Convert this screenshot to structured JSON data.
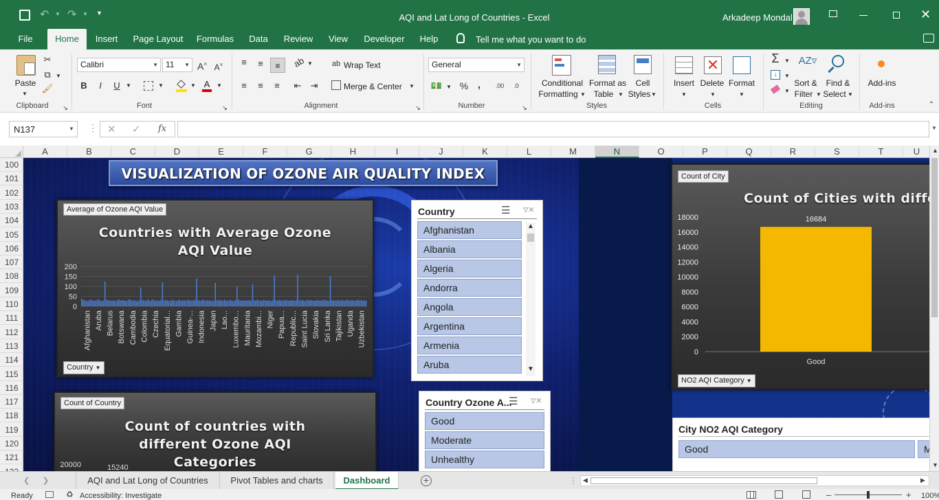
{
  "titlebar": {
    "doc_title": "AQI and Lat Long of Countries  -  Excel",
    "user": "Arkadeep Mondal"
  },
  "ribbon_tabs": [
    "File",
    "Home",
    "Insert",
    "Page Layout",
    "Formulas",
    "Data",
    "Review",
    "View",
    "Developer",
    "Help"
  ],
  "tell_me": "Tell me what you want to do",
  "ribbon": {
    "paste": "Paste",
    "font_name": "Calibri",
    "font_size": "11",
    "wrap_text": "Wrap Text",
    "merge_center": "Merge & Center",
    "number_format": "General",
    "cond_fmt_1": "Conditional",
    "cond_fmt_2": "Formatting",
    "fmt_table_1": "Format as",
    "fmt_table_2": "Table",
    "cell_styles_1": "Cell",
    "cell_styles_2": "Styles",
    "insert": "Insert",
    "delete": "Delete",
    "format": "Format",
    "sort_1": "Sort &",
    "sort_2": "Filter",
    "find_1": "Find &",
    "find_2": "Select",
    "addins": "Add-ins",
    "groups": {
      "clipboard": "Clipboard",
      "font": "Font",
      "alignment": "Alignment",
      "number": "Number",
      "styles": "Styles",
      "cells": "Cells",
      "editing": "Editing",
      "addins": "Add-ins"
    }
  },
  "formula_bar": {
    "name_box": "N137",
    "fx": "fx",
    "formula": ""
  },
  "columns": [
    "A",
    "B",
    "C",
    "D",
    "E",
    "F",
    "G",
    "H",
    "I",
    "J",
    "K",
    "L",
    "M",
    "N",
    "O",
    "P",
    "Q",
    "R",
    "S",
    "T",
    "U"
  ],
  "selected_column": "N",
  "rows": [
    "100",
    "101",
    "102",
    "103",
    "104",
    "105",
    "106",
    "107",
    "108",
    "109",
    "110",
    "111",
    "112",
    "113",
    "114",
    "115",
    "116",
    "117",
    "118",
    "119",
    "120",
    "121",
    "122"
  ],
  "dashboard": {
    "banner": "VISUALIZATION OF OZONE AIR QUALITY INDEX",
    "chart1": {
      "tag": "Average of Ozone AQI Value",
      "title": "Countries with Average Ozone AQI Value",
      "filter": "Country"
    },
    "chart2": {
      "tag": "Count of Country",
      "title": "Count of countries with different Ozone AQI Categories"
    },
    "chart3": {
      "tag": "Count of City",
      "title": "Count of Cities with differe",
      "filter": "NO2 AQI Category"
    },
    "slicer_country": {
      "title": "Country",
      "items": [
        "Afghanistan",
        "Albania",
        "Algeria",
        "Andorra",
        "Angola",
        "Argentina",
        "Armenia",
        "Aruba"
      ]
    },
    "slicer_ozone": {
      "title": "Country Ozone A...",
      "items": [
        "Good",
        "Moderate",
        "Unhealthy"
      ]
    },
    "slicer_no2": {
      "title": "City NO2 AQI Category",
      "items": [
        "Good",
        "M"
      ]
    }
  },
  "chart_data": [
    {
      "type": "bar",
      "title": "Countries with Average Ozone AQI Value",
      "ylim": [
        0,
        200
      ],
      "yticks": [
        "200",
        "150",
        "100",
        "50",
        "0"
      ],
      "category_labels": [
        "Afghanistan",
        "Aruba",
        "Belarus",
        "Botswana",
        "Cambodia",
        "Colombia",
        "Czechia",
        "Equatorial...",
        "Gambia",
        "Guinea-...",
        "Indonesia",
        "Japan",
        "Lao...",
        "Luxembo...",
        "Mauritania",
        "Mozambi...",
        "Niger",
        "Papua...",
        "Republic...",
        "Saint Lucia",
        "Slovakia",
        "Sri Lanka",
        "Tajikistan",
        "Uganda",
        "Uzbekistan"
      ],
      "values": [
        38,
        33,
        30,
        28,
        26,
        31,
        34,
        30,
        29,
        27,
        32,
        35,
        28,
        26,
        30,
        125,
        33,
        29,
        31,
        27,
        28,
        30,
        26,
        32,
        34,
        29,
        31,
        30,
        28,
        27,
        33,
        35,
        29,
        30,
        31,
        27,
        26,
        30,
        95,
        32,
        29,
        28,
        30,
        33,
        26,
        31,
        34,
        28,
        29,
        30,
        27,
        32,
        120,
        30,
        29,
        31,
        28,
        27,
        33,
        30,
        29,
        26,
        31,
        32,
        28,
        30,
        29,
        27,
        33,
        31,
        28,
        29,
        30,
        32,
        140,
        31,
        28,
        29,
        33,
        30,
        27,
        31,
        29,
        28,
        30,
        26,
        118,
        32,
        29,
        31,
        30,
        28,
        33,
        27,
        29,
        30,
        31,
        28,
        26,
        32,
        100,
        33,
        29,
        30,
        28,
        31,
        27,
        32,
        30,
        29,
        110,
        31,
        28,
        33,
        30,
        27,
        29,
        32,
        31,
        28,
        30,
        29,
        26,
        31,
        155,
        30,
        28,
        32,
        29,
        31,
        27,
        33,
        30,
        28,
        29,
        31,
        30,
        27,
        32,
        158,
        29,
        30,
        31,
        28,
        26,
        33,
        30,
        29,
        31,
        28,
        27,
        32,
        30,
        29,
        28,
        31,
        33,
        30,
        29,
        27,
        152,
        31,
        28,
        30,
        29,
        32,
        27,
        30,
        31,
        28,
        29,
        33,
        30,
        27,
        31,
        29,
        28,
        30,
        32,
        29,
        31,
        27,
        30,
        28
      ]
    },
    {
      "type": "bar",
      "title": "Count of countries with different Ozone AQI Categories",
      "yticks": [
        "20000"
      ],
      "data_labels": [
        "15240"
      ],
      "values": [
        15240
      ]
    },
    {
      "type": "bar",
      "title": "Count of Cities with differe",
      "categories": [
        "Good"
      ],
      "values": [
        16684
      ],
      "ylim": [
        0,
        18000
      ],
      "yticks": [
        "18000",
        "16000",
        "14000",
        "12000",
        "10000",
        "8000",
        "6000",
        "4000",
        "2000",
        "0"
      ],
      "bar_color": "#f5b800"
    }
  ],
  "sheet_tabs": [
    "AQI and Lat Long of Countries",
    "Pivot Tables and charts",
    "Dashboard"
  ],
  "active_sheet": "Dashboard",
  "status": {
    "ready": "Ready",
    "accessibility": "Accessibility: Investigate",
    "zoom": "100%"
  },
  "colors": {
    "excel_green": "#217346",
    "dash_bg": "#10206e",
    "slicer_item": "#b8c7e6"
  }
}
